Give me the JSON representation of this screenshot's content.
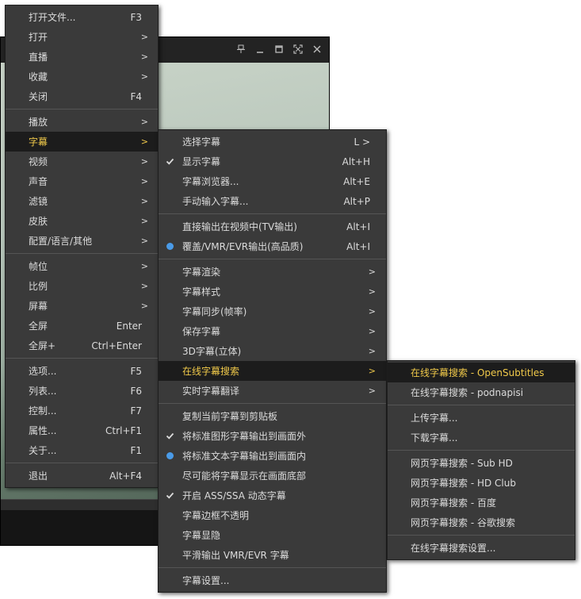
{
  "player": {
    "titlebar_icons": [
      "pin-icon",
      "minimize-icon",
      "maximize-icon",
      "fullscreen-icon",
      "close-icon"
    ]
  },
  "main_menu": [
    {
      "label": "打开文件...",
      "shortcut": "F3"
    },
    {
      "label": "打开",
      "submenu": true
    },
    {
      "label": "直播",
      "submenu": true
    },
    {
      "label": "收藏",
      "submenu": true
    },
    {
      "label": "关闭",
      "shortcut": "F4"
    },
    {
      "sep": true
    },
    {
      "label": "播放",
      "submenu": true
    },
    {
      "label": "字幕",
      "submenu": true,
      "highlighted": true
    },
    {
      "label": "视频",
      "submenu": true
    },
    {
      "label": "声音",
      "submenu": true
    },
    {
      "label": "滤镜",
      "submenu": true
    },
    {
      "label": "皮肤",
      "submenu": true
    },
    {
      "label": "配置/语言/其他",
      "submenu": true
    },
    {
      "sep": true
    },
    {
      "label": "帧位",
      "submenu": true
    },
    {
      "label": "比例",
      "submenu": true
    },
    {
      "label": "屏幕",
      "submenu": true
    },
    {
      "label": "全屏",
      "shortcut": "Enter"
    },
    {
      "label": "全屏+",
      "shortcut": "Ctrl+Enter"
    },
    {
      "sep": true
    },
    {
      "label": "选项...",
      "shortcut": "F5"
    },
    {
      "label": "列表...",
      "shortcut": "F6"
    },
    {
      "label": "控制...",
      "shortcut": "F7"
    },
    {
      "label": "属性...",
      "shortcut": "Ctrl+F1"
    },
    {
      "label": "关于...",
      "shortcut": "F1"
    },
    {
      "sep": true
    },
    {
      "label": "退出",
      "shortcut": "Alt+F4"
    }
  ],
  "subtitle_menu": [
    {
      "label": "选择字幕",
      "shortcut": "L >"
    },
    {
      "label": "显示字幕",
      "shortcut": "Alt+H",
      "check": true
    },
    {
      "label": "字幕浏览器...",
      "shortcut": "Alt+E"
    },
    {
      "label": "手动输入字幕...",
      "shortcut": "Alt+P"
    },
    {
      "sep": true
    },
    {
      "label": "直接输出在视频中(TV输出)",
      "shortcut": "Alt+I"
    },
    {
      "label": "覆盖/VMR/EVR输出(高品质)",
      "shortcut": "Alt+I",
      "radio": true
    },
    {
      "sep": true
    },
    {
      "label": "字幕渲染",
      "submenu": true
    },
    {
      "label": "字幕样式",
      "submenu": true
    },
    {
      "label": "字幕同步(帧率)",
      "submenu": true
    },
    {
      "label": "保存字幕",
      "submenu": true
    },
    {
      "label": "3D字幕(立体)",
      "submenu": true
    },
    {
      "label": "在线字幕搜索",
      "submenu": true,
      "highlighted": true
    },
    {
      "label": "实时字幕翻译",
      "submenu": true
    },
    {
      "sep": true
    },
    {
      "label": "复制当前字幕到剪贴板"
    },
    {
      "label": "将标准图形字幕输出到画面外",
      "check": true
    },
    {
      "label": "将标准文本字幕输出到画面内",
      "radio": true
    },
    {
      "label": "尽可能将字幕显示在画面底部"
    },
    {
      "label": "开启 ASS/SSA 动态字幕",
      "check": true
    },
    {
      "label": "字幕边框不透明"
    },
    {
      "label": "字幕显隐"
    },
    {
      "label": "平滑输出 VMR/EVR 字幕"
    },
    {
      "sep": true
    },
    {
      "label": "字幕设置..."
    }
  ],
  "online_search_menu": [
    {
      "label": "在线字幕搜索 - OpenSubtitles",
      "highlighted": true
    },
    {
      "label": "在线字幕搜索 - podnapisi"
    },
    {
      "sep": true
    },
    {
      "label": "上传字幕..."
    },
    {
      "label": "下载字幕..."
    },
    {
      "sep": true
    },
    {
      "label": "网页字幕搜索 - Sub HD"
    },
    {
      "label": "网页字幕搜索 - HD Club"
    },
    {
      "label": "网页字幕搜索 - 百度"
    },
    {
      "label": "网页字幕搜索 - 谷歌搜索"
    },
    {
      "sep": true
    },
    {
      "label": "在线字幕搜索设置..."
    }
  ],
  "arrow_glyph": ">",
  "colors": {
    "highlight_text": "#f0c94a",
    "radio": "#4a9be8",
    "menu_bg": "#3a3a3a"
  }
}
